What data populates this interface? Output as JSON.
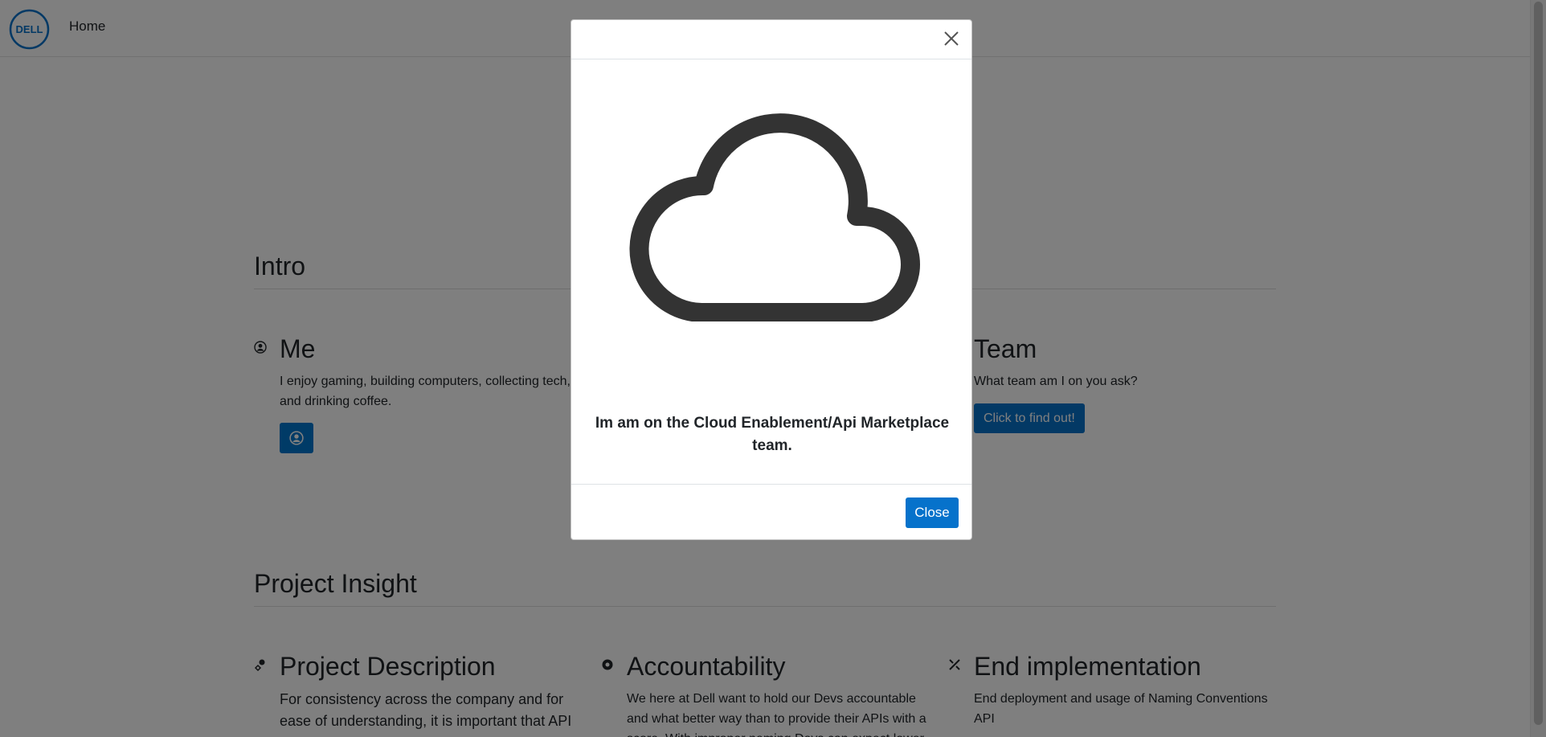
{
  "navbar": {
    "logo_text": "DELL",
    "home_label": "Home"
  },
  "intro": {
    "heading": "Intro",
    "me": {
      "title": "Me",
      "text": "I enjoy gaming, building computers, collecting tech, and drinking coffee."
    },
    "team": {
      "title": "Team",
      "text": "What team am I on you ask?",
      "button_label": "Click to find out!"
    }
  },
  "project": {
    "heading": "Project Insight",
    "description": {
      "title": "Project Description",
      "text": "For consistency across the company and for ease of understanding, it is important that API"
    },
    "accountability": {
      "title": "Accountability",
      "text": "We here at Dell want to hold our Devs accountable and what better way than to provide their APIs with a score. With improper naming Devs can expect lower"
    },
    "implementation": {
      "title": "End implementation",
      "text": "End deployment and usage of Naming Conventions API"
    }
  },
  "modal": {
    "icon": "cloud-icon",
    "message": "Im am on the Cloud Enablement/Api Marketplace team.",
    "close_label": "Close"
  },
  "colors": {
    "brand_blue": "#0672cb",
    "backdrop": "rgba(0,0,0,0.5)"
  }
}
